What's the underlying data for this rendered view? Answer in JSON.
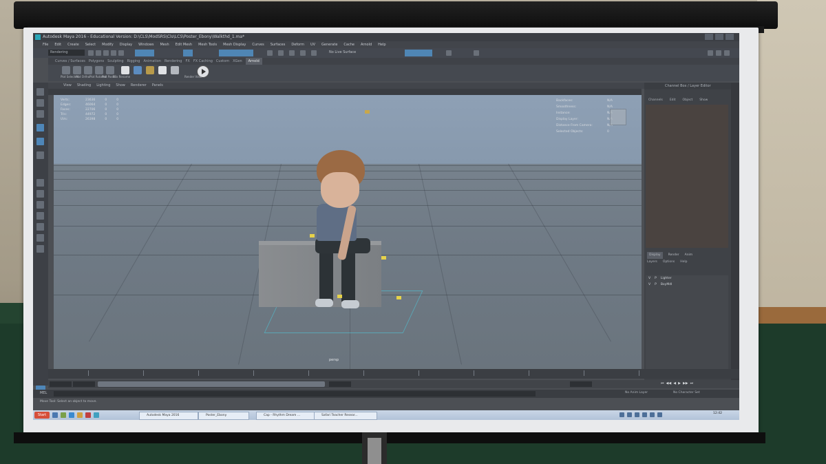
{
  "window": {
    "title": "Autodesk Maya 2016 - Educational Version: D:\\CLS\\ModSRS\\Cls\\LCS\\Poster_Ebony\\Walkthd_1.ma*"
  },
  "menubar": [
    "File",
    "Edit",
    "Create",
    "Select",
    "Modify",
    "Display",
    "Windows",
    "Mesh",
    "Edit Mesh",
    "Mesh Tools",
    "Mesh Display",
    "Curves",
    "Surfaces",
    "Deform",
    "UV",
    "Generate",
    "Cache",
    "Arnold",
    "Help"
  ],
  "status": {
    "mode": "Rendering",
    "live_surface": "No Live Surface"
  },
  "shelf": {
    "tabs": [
      "Curves / Surfaces",
      "Polygons",
      "Sculpting",
      "Rigging",
      "Animation",
      "Rendering",
      "FX",
      "FX Caching",
      "Custom",
      "XGen",
      "Arnold"
    ],
    "active_tab": "Arnold",
    "buttons": [
      "Plot Selected",
      "Plot Ortho",
      "Plot Rotated",
      "Plot Paste",
      "FBx Rename",
      "",
      "",
      "",
      "",
      "Render View"
    ]
  },
  "panel_menu": [
    "View",
    "Shading",
    "Lighting",
    "Show",
    "Renderer",
    "Panels"
  ],
  "stats": {
    "rows": [
      {
        "k": "Verts:",
        "a": "23636",
        "b": "0",
        "c": "0"
      },
      {
        "k": "Edges:",
        "a": "46064",
        "b": "0",
        "c": "0"
      },
      {
        "k": "Faces:",
        "a": "22706",
        "b": "0",
        "c": "0"
      },
      {
        "k": "Tris:",
        "a": "44972",
        "b": "0",
        "c": "0"
      },
      {
        "k": "UVs:",
        "a": "26398",
        "b": "0",
        "c": "0"
      }
    ]
  },
  "hud": {
    "rows": [
      {
        "k": "Backfaces:",
        "v": "N/A"
      },
      {
        "k": "Smoothness:",
        "v": "N/A"
      },
      {
        "k": "Instance:",
        "v": "N/A"
      },
      {
        "k": "Display Layer:",
        "v": "N/A"
      },
      {
        "k": "Distance From Camera:",
        "v": "N/A"
      },
      {
        "k": "Selected Objects:",
        "v": "0"
      }
    ]
  },
  "viewport": {
    "camera_label": "persp"
  },
  "channel_box": {
    "title": "Channel Box / Layer Editor",
    "tabs": [
      "Channels",
      "Edit",
      "Object",
      "Show"
    ]
  },
  "layers": {
    "tabs": [
      "Display",
      "Render",
      "Anim"
    ],
    "active_tab": "Display",
    "menu": [
      "Layers",
      "Options",
      "Help"
    ],
    "items": [
      {
        "v": "V",
        "p": "P",
        "name": "Lighter"
      },
      {
        "v": "V",
        "p": "P",
        "name": "BoyMdl"
      }
    ]
  },
  "time": {
    "start": "1",
    "end": "120",
    "anim_layer": "No Anim Layer",
    "char_set": "No Character Set"
  },
  "cmdline": {
    "label": "MEL"
  },
  "helpline": {
    "text": "Move Tool: Select an object to move."
  },
  "taskbar": {
    "start": "Start",
    "tasks": [
      {
        "label": "Autodesk Maya 2016"
      },
      {
        "label": "Poster_Ebony"
      },
      {
        "label": "Cap - Rhythm Dream ..."
      },
      {
        "label": "Safari Teacher Resear..."
      }
    ],
    "clock": "12:42"
  },
  "colors": {
    "accent": "#4f86b5",
    "viewport_sky": "#8ea0b5",
    "panel": "#4c4f54"
  }
}
